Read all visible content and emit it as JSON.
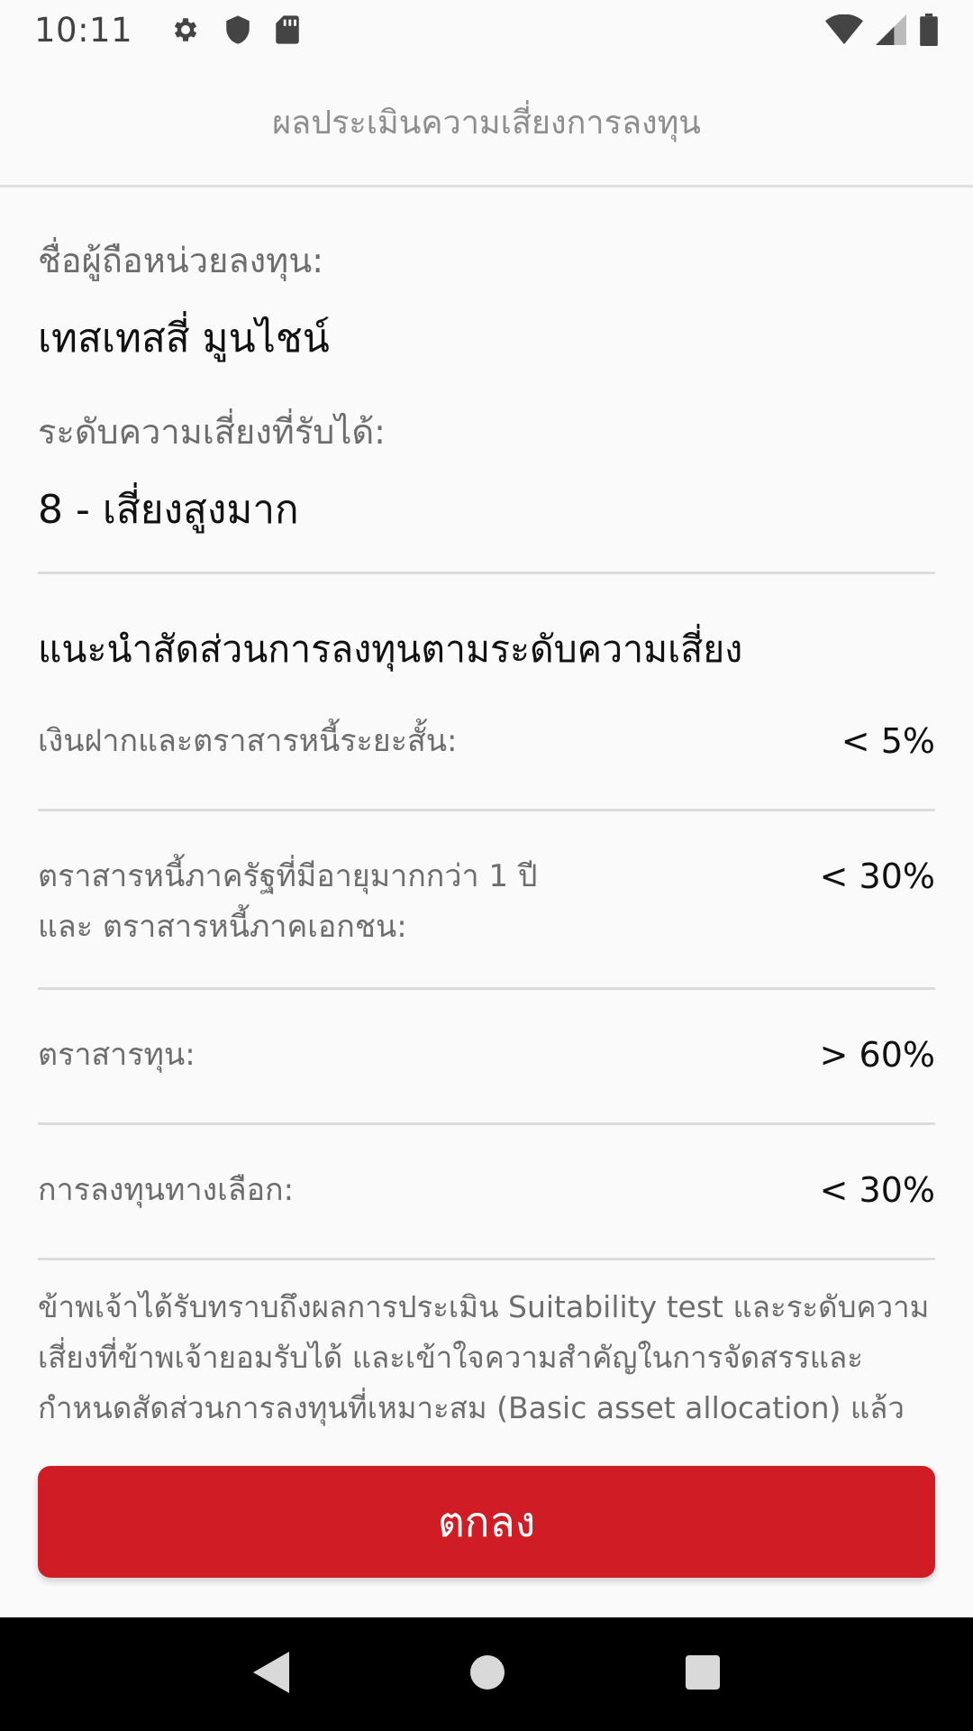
{
  "status_bar": {
    "time": "10:11",
    "icons_left": [
      "gear-icon",
      "shield-icon",
      "sd-card-icon"
    ],
    "icons_right": [
      "wifi-icon",
      "signal-icon",
      "battery-icon"
    ]
  },
  "app_bar": {
    "title": "ผลประเมินความเสี่ยงการลงทุน"
  },
  "holder": {
    "label": "ชื่อผู้ถือหน่วยลงทุน:",
    "name": "เทสเทสสี่ มูนไชน์"
  },
  "risk": {
    "label": "ระดับความเสี่ยงที่รับได้:",
    "value": "8 - เสี่ยงสูงมาก"
  },
  "allocation": {
    "title": "แนะนำสัดส่วนการลงทุนตามระดับความเสี่ยง",
    "rows": [
      {
        "label": "เงินฝากและตราสารหนี้ระยะสั้น:",
        "value": "< 5%"
      },
      {
        "label": "ตราสารหนี้ภาครัฐที่มีอายุมากกว่า 1 ปี และ ตราสารหนี้ภาคเอกชน:",
        "value": "< 30%"
      },
      {
        "label": "ตราสารทุน:",
        "value": "> 60%"
      },
      {
        "label": "การลงทุนทางเลือก:",
        "value": "< 30%"
      }
    ]
  },
  "disclaimer": "ข้าพเจ้าได้รับทราบถึงผลการประเมิน Suitability test และระดับความเสี่ยงที่ข้าพเจ้ายอมรับได้ และเข้าใจความสำคัญในการจัดสรรและกำหนดสัดส่วนการลงทุนที่เหมาะสม (Basic asset allocation) แล้ว",
  "buttons": {
    "ok_label": "ตกลง"
  },
  "nav_bar": {
    "icons": [
      "back-icon",
      "home-icon",
      "recents-icon"
    ]
  },
  "colors": {
    "accent": "#d01c24",
    "background": "#fafafa",
    "divider": "#dcdcdc"
  }
}
